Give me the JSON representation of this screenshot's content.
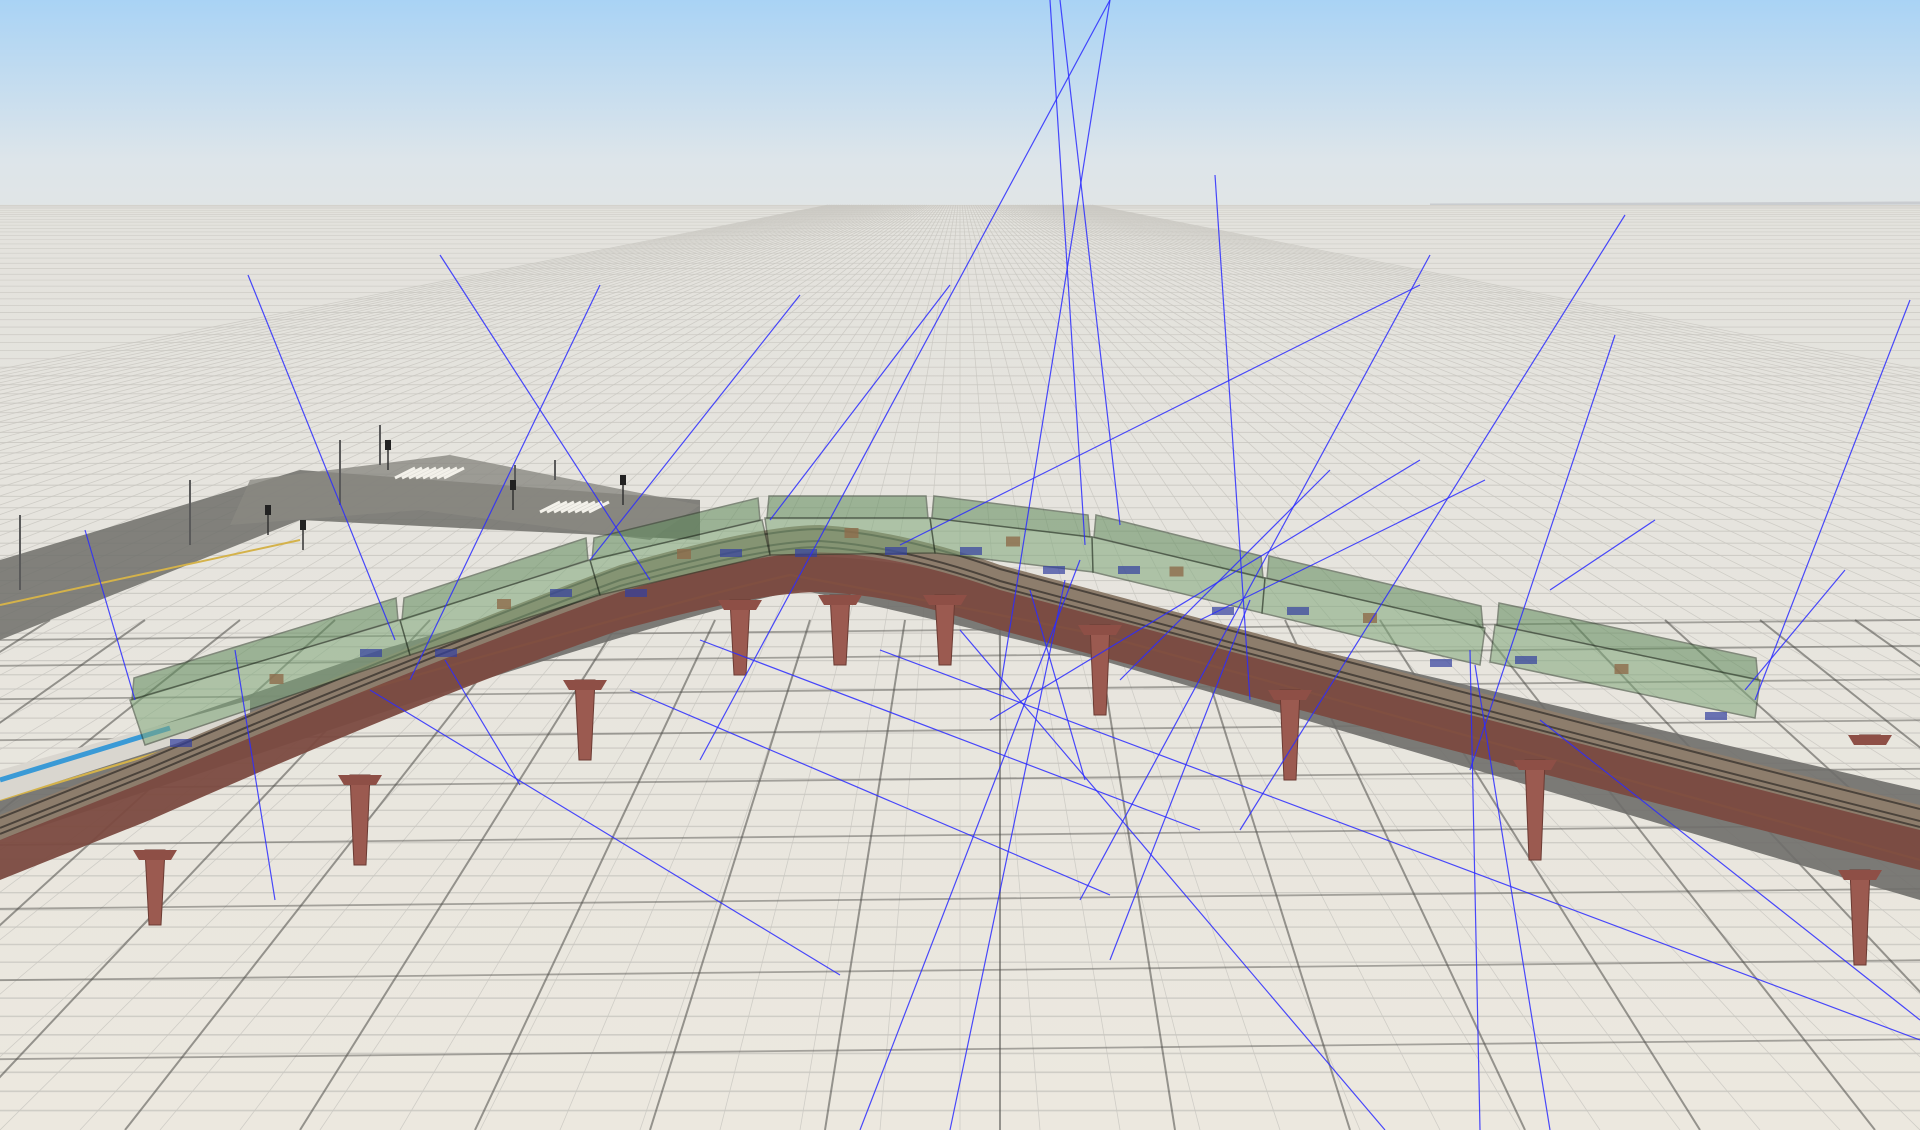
{
  "scene": {
    "kind": "3d-editor-viewport",
    "subject": "elevated-railway-curve-with-train-cars",
    "colors": {
      "sky_top": "#a9d3f5",
      "sky_horizon": "#e4e5e3",
      "ground": "#e7e4dc",
      "grid_line": "#c9c7c1",
      "grid_major": "#4e4d49",
      "road": "#6f6e6a",
      "road_marking_yellow": "#d4b24a",
      "viaduct_pier": "#9b5a50",
      "viaduct_deck": "#7b4a40",
      "rail_ballast": "#8d7d6c",
      "train_car_fill": "#7fa77a",
      "train_car_edge": "#2e3f2b",
      "debug_ray": "#2c2cff",
      "platform_blue": "#3a9ad6"
    },
    "train_cars": 8,
    "viaduct_piers": 11
  }
}
